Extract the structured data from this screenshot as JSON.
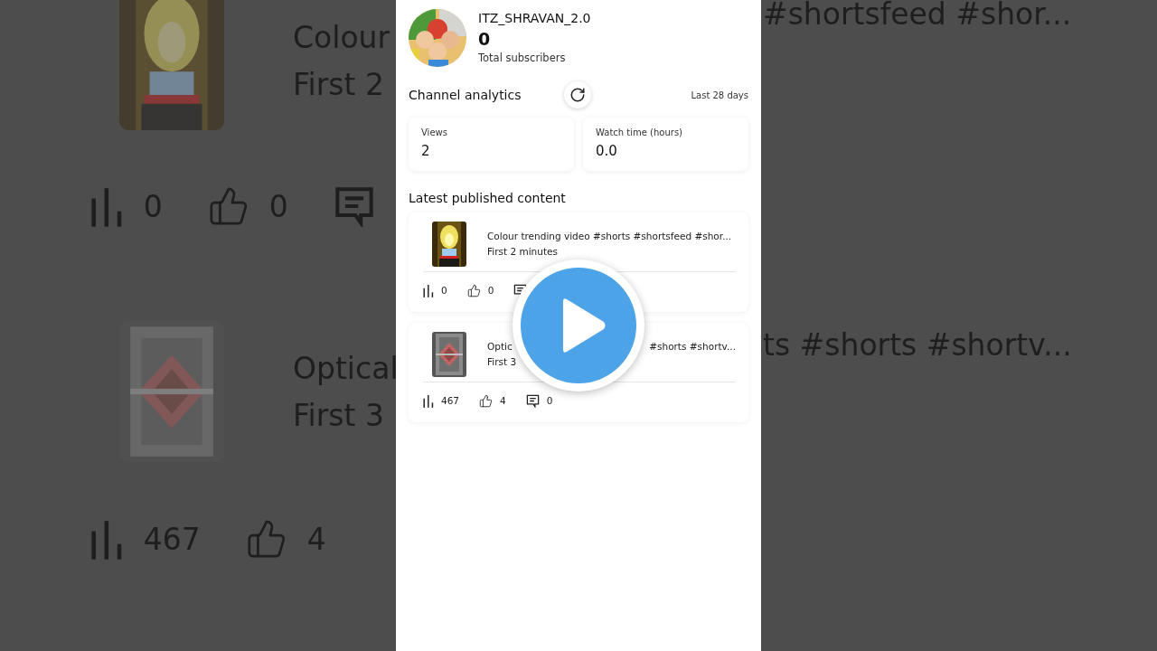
{
  "backdrop": {
    "left_items": [
      {
        "title": "Colour",
        "subtitle": "First 2",
        "stats": [
          {
            "kind": "views",
            "value": "0"
          },
          {
            "kind": "likes",
            "value": "0"
          },
          {
            "kind": "comments"
          }
        ]
      },
      {
        "title": "Optical",
        "subtitle": "First 3",
        "stats": [
          {
            "kind": "views",
            "value": "467"
          },
          {
            "kind": "likes",
            "value": "4"
          }
        ]
      }
    ],
    "right_texts": [
      "#shortsfeed #shor...",
      "ts #shorts #shortv..."
    ]
  },
  "channel": {
    "name": "ITZ_SHRAVAN_2.0",
    "subscribers": "0",
    "subscribers_label": "Total subscribers"
  },
  "analytics": {
    "title": "Channel analytics",
    "period": "Last 28 days",
    "metrics": [
      {
        "label": "Views",
        "value": "2"
      },
      {
        "label": "Watch time (hours)",
        "value": "0.0"
      }
    ]
  },
  "latest": {
    "title": "Latest published content",
    "items": [
      {
        "title_start": "Colour trending video #shorts #shortsfeed #shor...",
        "subtitle": "First 2 minutes",
        "stats": [
          {
            "kind": "views",
            "value": "0"
          },
          {
            "kind": "likes",
            "value": "0"
          },
          {
            "kind": "comments"
          }
        ]
      },
      {
        "title_start": "Optic",
        "title_end": "#shorts #shortv...",
        "subtitle": "First 3",
        "stats": [
          {
            "kind": "views",
            "value": "467"
          },
          {
            "kind": "likes",
            "value": "4"
          },
          {
            "kind": "comments",
            "value": "0"
          }
        ]
      }
    ]
  }
}
